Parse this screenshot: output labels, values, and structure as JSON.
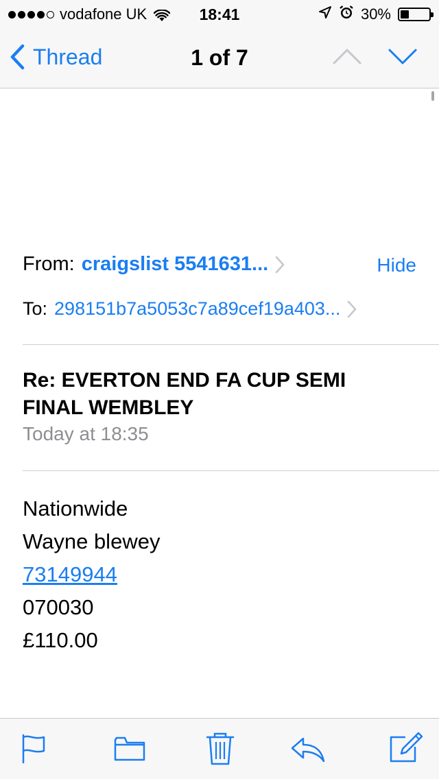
{
  "status_bar": {
    "signal_filled": 4,
    "signal_total": 5,
    "carrier": "vodafone UK",
    "time": "18:41",
    "battery_text": "30%",
    "battery_level": 0.3,
    "icons": [
      "wifi-icon",
      "location-icon",
      "alarm-icon",
      "battery-icon"
    ]
  },
  "nav": {
    "back_label": "Thread",
    "title": "1 of 7",
    "up_enabled": false,
    "down_enabled": true
  },
  "header": {
    "from_label": "From:",
    "from_value": "craigslist 5541631...",
    "hide_label": "Hide",
    "to_label": "To:",
    "to_value": "298151b7a5053c7a89cef19a403..."
  },
  "message": {
    "subject": "Re: EVERTON END FA CUP SEMI FINAL WEMBLEY",
    "date": "Today at 18:35",
    "body_lines": [
      "Nationwide",
      "Wayne blewey",
      "73149944",
      "070030",
      "£110.00"
    ]
  },
  "toolbar": {
    "items": [
      "flag-icon",
      "folder-icon",
      "trash-icon",
      "reply-icon",
      "compose-icon"
    ]
  },
  "colors": {
    "accent": "#1a7ef1",
    "secondary_text": "#8e8e93",
    "bar_background": "#f7f7f7"
  }
}
